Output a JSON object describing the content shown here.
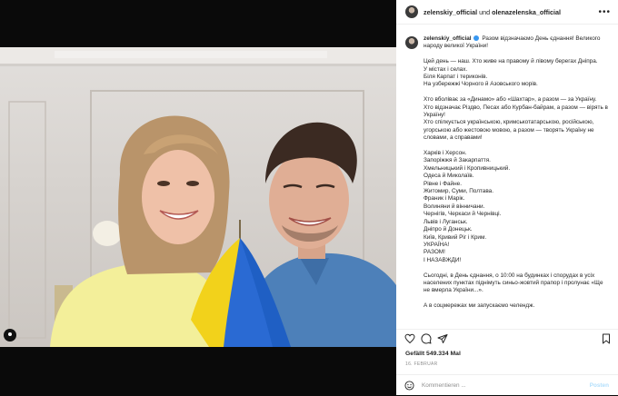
{
  "header": {
    "author": "zelenskiy_official",
    "connector": " und ",
    "coauthor": "olenazelenska_official",
    "more_icon": "more-horizontal-icon"
  },
  "caption": {
    "username": "zelenskiy_official",
    "lead": "Разом відзначаємо День єднання! Великого народу великої України!",
    "paragraphs": [
      "Цей день — наш. Хто живе на правому й лівому берегах Дніпра.\nУ містах і селах.\nБіля Карпат і териконів.\nНа узбережжі Чорного й Азовського морів.",
      "Хто вболіває за «Динамо» або «Шахтар», а разом — за Україну.\nХто відзначає Різдво, Песах або Курбан-байрам, а разом — вірять в Україну!\nХто спілкується українською, кримськотатарською, російською, угорською або жестовою мовою, а разом — творять Україну не словами, а справами!",
      "Харків і Херсон.\nЗапоріжжя й Закарпаття.\nХмельницький і Кропивницький.\nОдеса й Миколаїв.\nРівне і Файне.\nЖитомир, Суми, Полтава.\nФраник і Марік.\nВолиняни й вінничани.\nЧернігів, Черкаси й Чернівці.\nЛьвів і Луганськ.\nДніпро й Донецьк.\nКиїв, Кривий Ріг і Крим.\nУКРАЇНА!\nРАЗОМ!\nІ НАЗАВЖДИ!",
      "Сьогодні, в День єднання, о 10:00 на будинках і спорудах в усіх населених пунктах піднімуть синьо-жовтий прапор і пролунає «Ще не вмерла України...».",
      "А в соцмережах ми запускаємо челендж."
    ]
  },
  "actions": {
    "like_icon": "heart-icon",
    "comment_icon": "comment-icon",
    "share_icon": "share-icon",
    "save_icon": "bookmark-icon"
  },
  "likes": "Gefällt 549.334 Mal",
  "date": "16. FEBRUAR",
  "comment_box": {
    "emoji_icon": "emoji-icon",
    "placeholder": "Kommentieren ...",
    "post_label": "Posten"
  },
  "photo": {
    "tag_icon": "user-tag-icon",
    "flag_colors": [
      "#1f5fc4",
      "#f2d21b"
    ]
  }
}
